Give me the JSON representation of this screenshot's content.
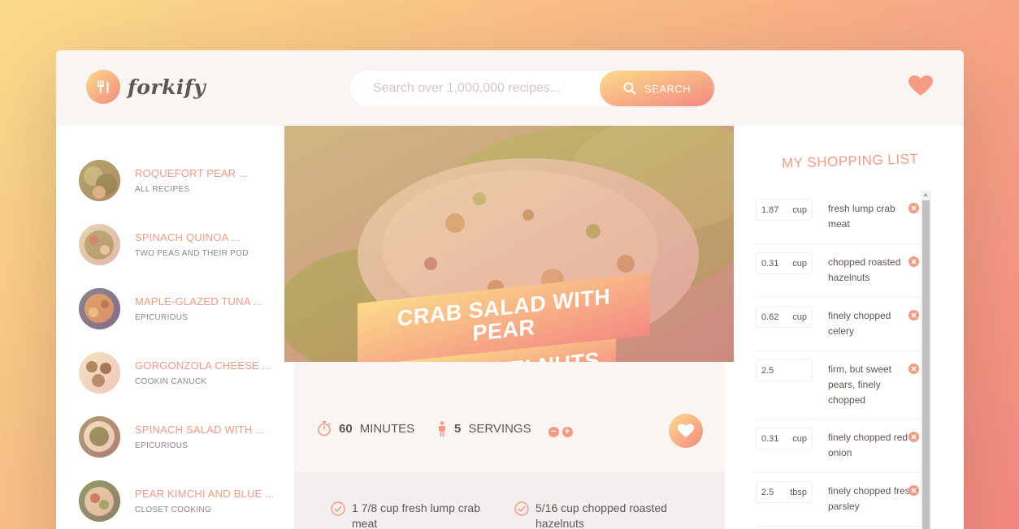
{
  "header": {
    "logo_text": "forkify",
    "search_placeholder": "Search over 1,000,000 recipes...",
    "search_button": "Search"
  },
  "results": [
    {
      "title": "Roquefort Pear ...",
      "author": "All Recipes"
    },
    {
      "title": "Spinach Quinoa ...",
      "author": "Two Peas and Their Pod"
    },
    {
      "title": "Maple-Glazed Tuna ...",
      "author": "Epicurious"
    },
    {
      "title": "Gorgonzola Cheese ...",
      "author": "Cookin Canuck"
    },
    {
      "title": "Spinach Salad with ...",
      "author": "Epicurious"
    },
    {
      "title": "Pear Kimchi and Blue ...",
      "author": "Closet Cooking"
    }
  ],
  "recipe": {
    "title_line1": "Crab Salad with Pear",
    "title_line2": "and Hazelnuts",
    "minutes": "60",
    "minutes_label": "minutes",
    "servings": "5",
    "servings_label": "servings",
    "ingredients": [
      {
        "count": "1 7/8",
        "text": "cup fresh lump crab meat"
      },
      {
        "count": "5/16",
        "text": "cup chopped roasted hazelnuts"
      }
    ]
  },
  "shopping": {
    "title": "My Shopping List",
    "items": [
      {
        "qty": "1.87",
        "unit": "cup",
        "desc": "fresh lump crab meat"
      },
      {
        "qty": "0.31",
        "unit": "cup",
        "desc": "chopped roasted hazelnuts"
      },
      {
        "qty": "0.62",
        "unit": "cup",
        "desc": "finely chopped celery"
      },
      {
        "qty": "2.5",
        "unit": "",
        "desc": "firm, but sweet pears, finely chopped"
      },
      {
        "qty": "0.31",
        "unit": "cup",
        "desc": "finely chopped red onion"
      },
      {
        "qty": "2.5",
        "unit": "tbsp",
        "desc": "finely chopped fresh parsley"
      }
    ]
  },
  "colors": {
    "accent_start": "#fbdb89",
    "accent_end": "#f48982",
    "text": "#615551"
  }
}
